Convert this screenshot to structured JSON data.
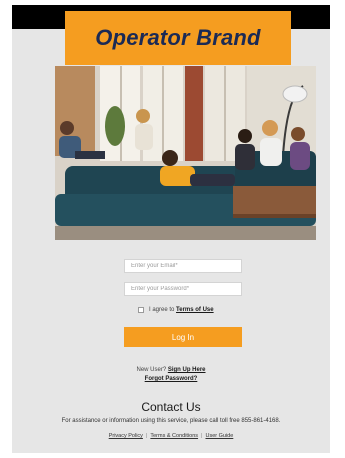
{
  "brand": {
    "title": "Operator Brand",
    "color": "#f59d20",
    "text_color": "#1b2a55"
  },
  "hero": {
    "icon": "hero-photo"
  },
  "form": {
    "email_placeholder": "Enter your Email*",
    "password_placeholder": "Enter your Password*",
    "agree_text": "I agree to ",
    "terms_label": "Terms of Use",
    "agree_checked": false,
    "login_label": "Log In"
  },
  "links": {
    "new_user_text": "New User? ",
    "sign_up_label": "Sign Up Here",
    "forgot_label": "Forgot Password?"
  },
  "contact": {
    "title": "Contact Us",
    "line": "For assistance or information using this service, please call toll free 855-861-4168."
  },
  "footer": {
    "privacy": "Privacy Policy",
    "terms": "Terms & Conditions",
    "guide": "User Guide",
    "separator": "|"
  }
}
